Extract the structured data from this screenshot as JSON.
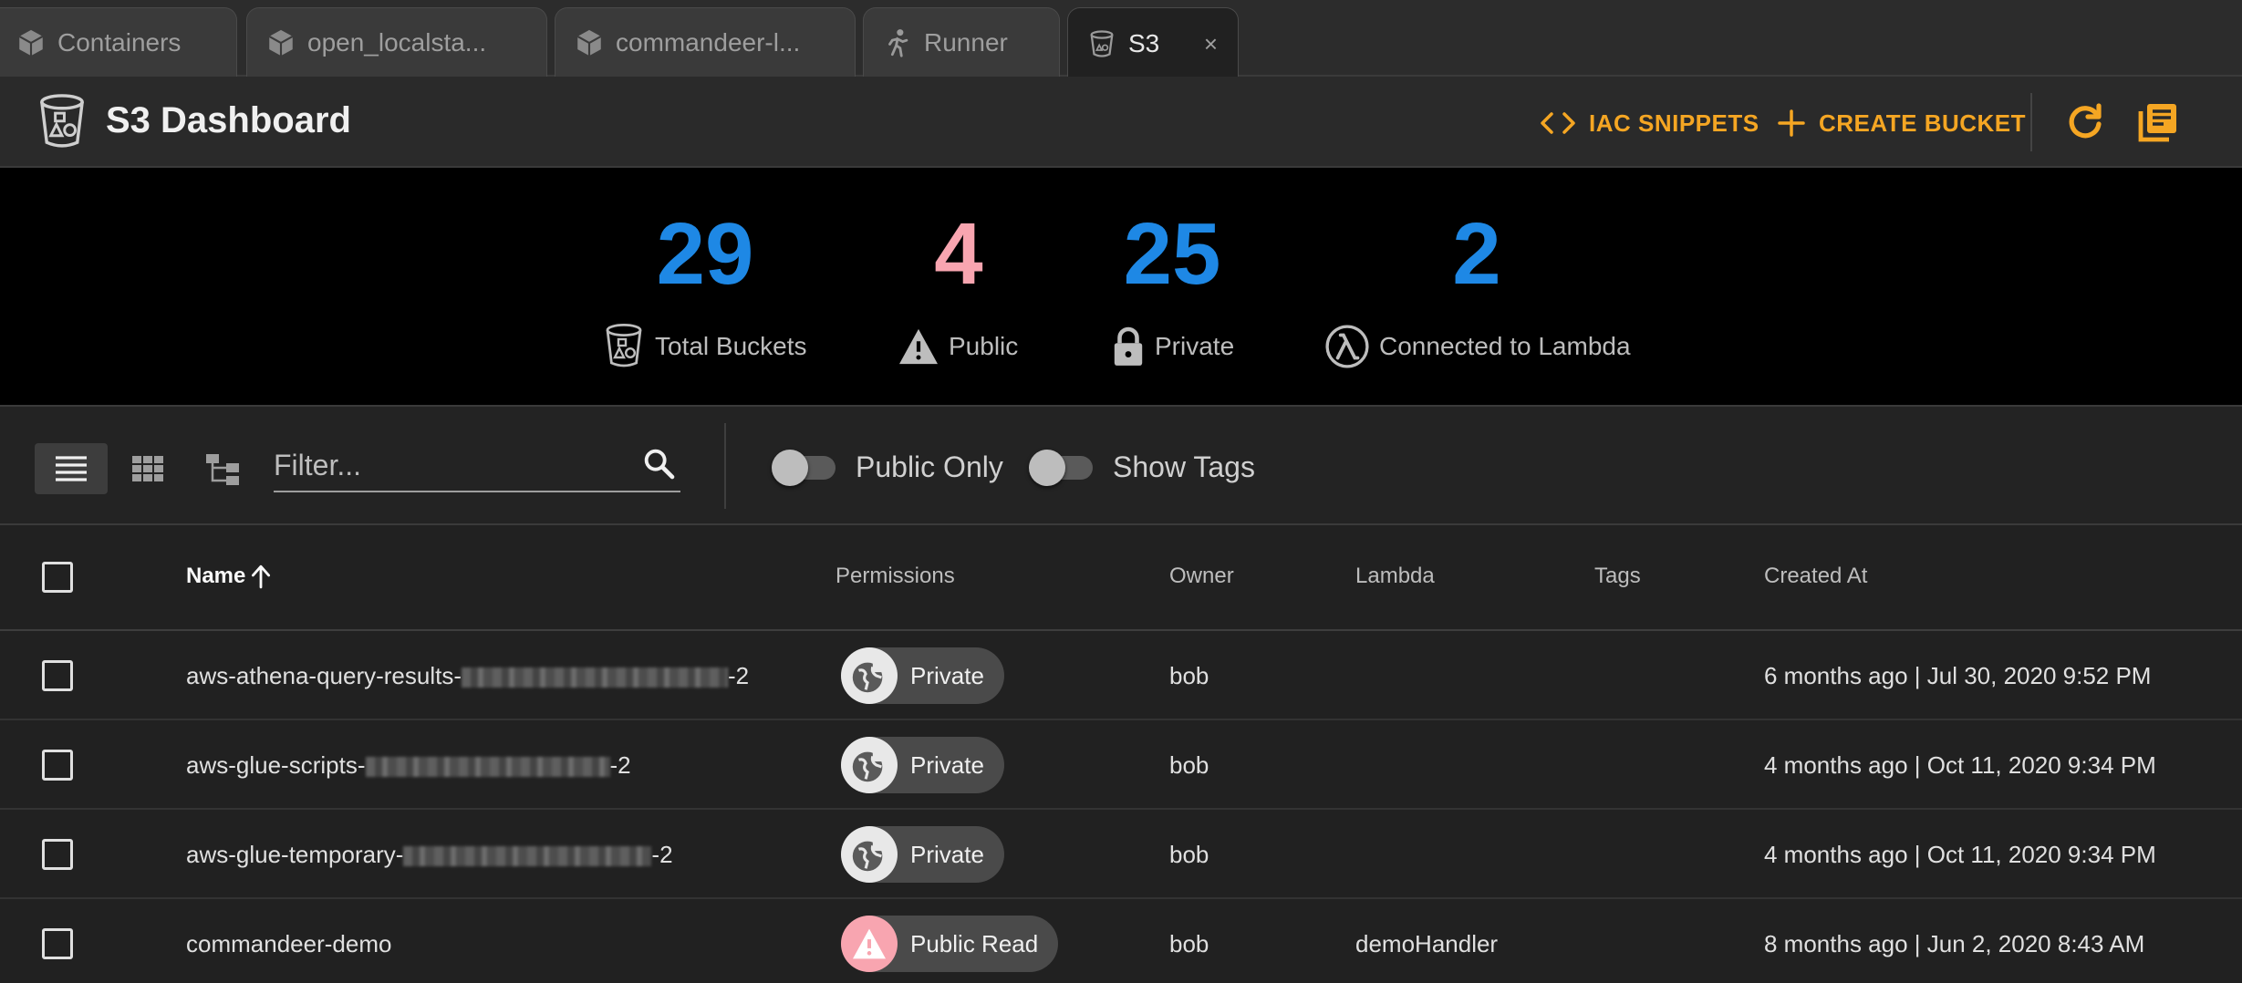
{
  "tabs": [
    {
      "label": "Containers",
      "icon": "cube-icon"
    },
    {
      "label": "open_localsta...",
      "icon": "cube-icon"
    },
    {
      "label": "commandeer-l...",
      "icon": "cube-icon"
    },
    {
      "label": "Runner",
      "icon": "runner-icon"
    },
    {
      "label": "S3",
      "icon": "bucket-icon",
      "close": "×"
    }
  ],
  "header": {
    "title": "S3 Dashboard",
    "iac_label": "IAC SNIPPETS",
    "create_label": "CREATE BUCKET",
    "accent": "#f5a623"
  },
  "stats": [
    {
      "value": "29",
      "label": "Total Buckets",
      "color": "#1e88e5",
      "icon": "bucket-icon"
    },
    {
      "value": "4",
      "label": "Public",
      "color": "#f8a5b0",
      "icon": "warning-icon"
    },
    {
      "value": "25",
      "label": "Private",
      "color": "#1e88e5",
      "icon": "lock-icon"
    },
    {
      "value": "2",
      "label": "Connected to Lambda",
      "color": "#1e88e5",
      "icon": "lambda-icon"
    }
  ],
  "toolbar": {
    "filter_placeholder": "Filter...",
    "public_only_label": "Public Only",
    "show_tags_label": "Show Tags"
  },
  "table": {
    "columns": {
      "name": "Name",
      "permissions": "Permissions",
      "owner": "Owner",
      "lambda": "Lambda",
      "tags": "Tags",
      "created": "Created At"
    },
    "rows": [
      {
        "name_prefix": "aws-athena-query-results-",
        "name_suffix": "-2",
        "permission": "Private",
        "owner": "bob",
        "lambda": "",
        "tags": "",
        "created": "6 months ago | Jul 30, 2020 9:52 PM"
      },
      {
        "name_prefix": "aws-glue-scripts-",
        "name_suffix": "-2",
        "permission": "Private",
        "owner": "bob",
        "lambda": "",
        "tags": "",
        "created": "4 months ago | Oct 11, 2020 9:34 PM"
      },
      {
        "name_prefix": "aws-glue-temporary-",
        "name_suffix": "-2",
        "permission": "Private",
        "owner": "bob",
        "lambda": "",
        "tags": "",
        "created": "4 months ago | Oct 11, 2020 9:34 PM"
      },
      {
        "name_prefix": "commandeer-demo",
        "name_suffix": "",
        "permission": "Public Read",
        "owner": "bob",
        "lambda": "demoHandler",
        "tags": "",
        "created": "8 months ago | Jun 2, 2020 8:43 AM"
      }
    ]
  }
}
